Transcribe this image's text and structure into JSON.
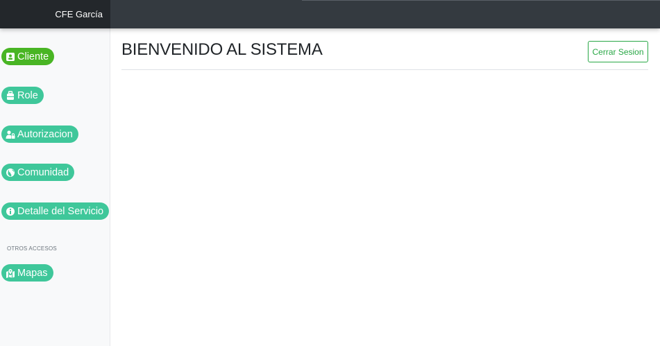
{
  "brand": "CFE García",
  "nav": {
    "items": [
      {
        "label": "Cliente",
        "icon": "id-card-icon"
      },
      {
        "label": "Role",
        "icon": "briefcase-icon"
      },
      {
        "label": "Autorizacion",
        "icon": "user-lock-icon"
      },
      {
        "label": "Comunidad",
        "icon": "globe-icon"
      },
      {
        "label": "Detalle del Servicio",
        "icon": "info-circle-icon"
      }
    ],
    "section_label": "OTROS ACCESOS",
    "other_items": [
      {
        "label": "Mapas",
        "icon": "map-marked-icon"
      }
    ]
  },
  "main": {
    "title": "BIENVENIDO AL SISTEMA",
    "logout_label": "Cerrar Sesion"
  },
  "colors": {
    "topbar": "#343a40",
    "brand_bg": "#23272b",
    "nav_button": "#3fc79a",
    "nav_button_active": "#49b524",
    "logout": "#28a745"
  }
}
